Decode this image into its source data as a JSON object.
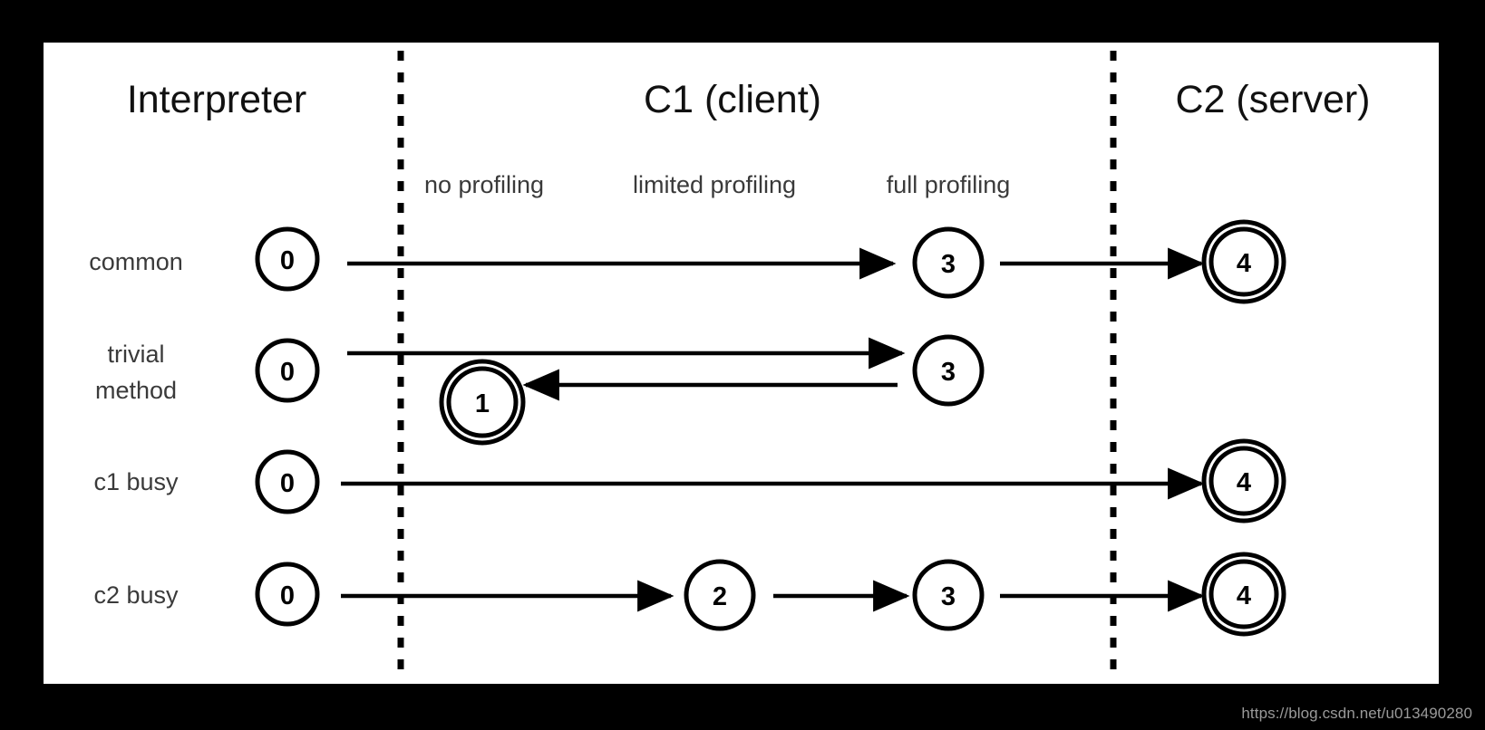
{
  "watermark": "https://blog.csdn.net/u013490280",
  "columns": [
    {
      "id": "interpreter",
      "label": "Interpreter"
    },
    {
      "id": "c1-client",
      "label": "C1 (client)"
    },
    {
      "id": "c2-server",
      "label": "C2 (server)"
    }
  ],
  "subheaders": [
    {
      "id": "no-profiling",
      "label": "no profiling"
    },
    {
      "id": "limited-profiling",
      "label": "limited profiling"
    },
    {
      "id": "full-profiling",
      "label": "full profiling"
    }
  ],
  "rows": [
    {
      "id": "common",
      "label": "common"
    },
    {
      "id": "trivial-method",
      "label_line1": "trivial",
      "label_line2": "method"
    },
    {
      "id": "c1-busy",
      "label": "c1 busy"
    },
    {
      "id": "c2-busy",
      "label": "c2 busy"
    }
  ],
  "nodes": {
    "common": [
      {
        "level": "0",
        "double": false
      },
      {
        "level": "3",
        "double": false
      },
      {
        "level": "4",
        "double": true
      }
    ],
    "trivial_method": [
      {
        "level": "0",
        "double": false
      },
      {
        "level": "1",
        "double": true
      },
      {
        "level": "3",
        "double": false
      }
    ],
    "c1_busy": [
      {
        "level": "0",
        "double": false
      },
      {
        "level": "4",
        "double": true
      }
    ],
    "c2_busy": [
      {
        "level": "0",
        "double": false
      },
      {
        "level": "2",
        "double": false
      },
      {
        "level": "3",
        "double": false
      },
      {
        "level": "4",
        "double": true
      }
    ]
  },
  "colors": {
    "background": "#000000",
    "panel": "#ffffff",
    "stroke": "#000000",
    "text": "#1a1a1a",
    "muted_text": "#3a3a3a",
    "watermark": "#9a9a9a"
  }
}
